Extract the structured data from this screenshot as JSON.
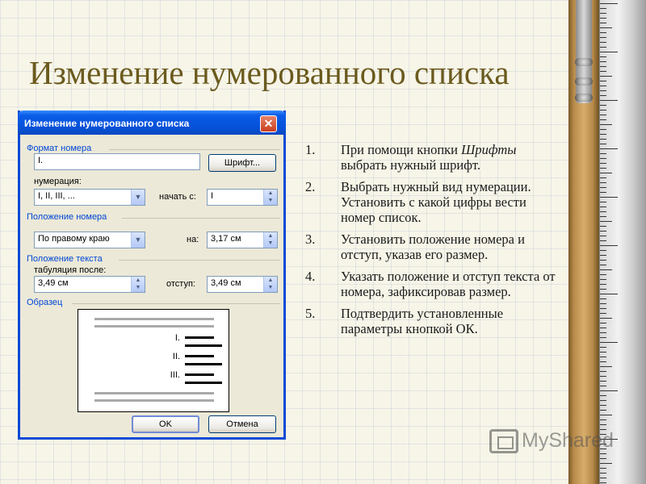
{
  "slide": {
    "title": "Изменение нумерованного списка",
    "steps": [
      {
        "num": "1.",
        "pre": "При помощи кнопки ",
        "em": "Шрифты",
        "post": " выбрать нужный шрифт."
      },
      {
        "num": "2.",
        "pre": "Выбрать нужный вид нумерации. Установить с какой цифры вести номер список.",
        "em": "",
        "post": ""
      },
      {
        "num": "3.",
        "pre": "Установить положение номера и отступ, указав его размер.",
        "em": "",
        "post": ""
      },
      {
        "num": "4.",
        "pre": "Указать положение и отступ текста от номера, зафиксировав размер.",
        "em": "",
        "post": ""
      },
      {
        "num": "5.",
        "pre": "Подтвердить установленные параметры кнопкой ОК.",
        "em": "",
        "post": ""
      }
    ],
    "watermark": "MyShared"
  },
  "dialog": {
    "title": "Изменение нумерованного списка",
    "close_glyph": "✕",
    "format_group": "Формат номера",
    "format_value": "I.",
    "font_button": "Шрифт...",
    "numbering_label": "нумерация:",
    "numbering_value": "I, II, III, ...",
    "start_label": "начать с:",
    "start_value": "I",
    "position_group": "Положение номера",
    "position_value": "По правому краю",
    "at_label": "на:",
    "at_value": "3,17 см",
    "text_group": "Положение текста",
    "tab_label": "табуляция после:",
    "tab_value": "3,49 см",
    "indent_label": "отступ:",
    "indent_value": "3,49 см",
    "sample_group": "Образец",
    "preview_numbers": [
      "I.",
      "II.",
      "III."
    ],
    "ok_button": "OK",
    "cancel_button": "Отмена"
  },
  "colors": {
    "title": "#6b5a1e",
    "titlebar": "#0a5ce8",
    "group_label": "#0046d5"
  }
}
